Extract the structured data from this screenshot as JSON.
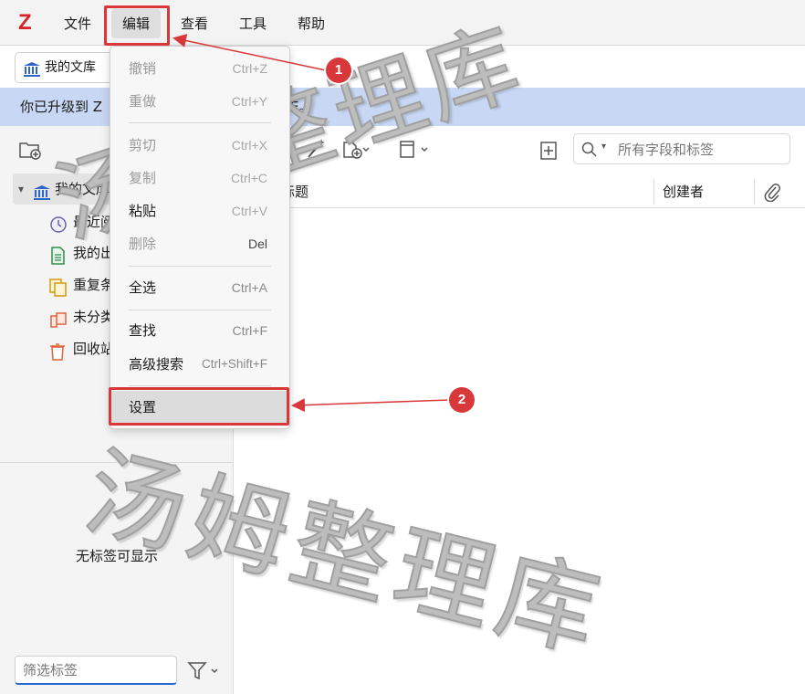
{
  "menubar": {
    "logo": "Z",
    "items": [
      {
        "label": "文件"
      },
      {
        "label": "编辑"
      },
      {
        "label": "查看"
      },
      {
        "label": "工具"
      },
      {
        "label": "帮助"
      }
    ]
  },
  "library_tab": {
    "label": "我的文库"
  },
  "banner": {
    "text_prefix": "你已升级到 Z",
    "text_suffix": "E。"
  },
  "collections": {
    "root": {
      "label": "我的文库"
    },
    "children": [
      {
        "label": "最近阅",
        "icon": "clock-icon"
      },
      {
        "label": "我的出",
        "icon": "document-icon"
      },
      {
        "label": "重复条",
        "icon": "duplicate-icon"
      },
      {
        "label": "未分类",
        "icon": "unfiled-icon"
      },
      {
        "label": "回收站",
        "icon": "trash-icon"
      }
    ]
  },
  "tags": {
    "empty_text": "无标签可显示",
    "filter_placeholder": "筛选标签"
  },
  "search": {
    "placeholder": "所有字段和标签"
  },
  "columns": {
    "title": "标题",
    "creator": "创建者"
  },
  "edit_menu": {
    "items": [
      {
        "label": "撤销",
        "shortcut": "Ctrl+Z",
        "enabled": false
      },
      {
        "label": "重做",
        "shortcut": "Ctrl+Y",
        "enabled": false
      },
      {
        "label": "剪切",
        "shortcut": "Ctrl+X",
        "enabled": false
      },
      {
        "label": "复制",
        "shortcut": "Ctrl+C",
        "enabled": false
      },
      {
        "label": "粘贴",
        "shortcut": "Ctrl+V",
        "enabled": true
      },
      {
        "label": "删除",
        "shortcut": "Del",
        "enabled": false
      },
      {
        "label": "全选",
        "shortcut": "Ctrl+A",
        "enabled": true
      },
      {
        "label": "查找",
        "shortcut": "Ctrl+F",
        "enabled": true
      },
      {
        "label": "高级搜索",
        "shortcut": "Ctrl+Shift+F",
        "enabled": true
      },
      {
        "label": "设置",
        "shortcut": "",
        "enabled": true
      }
    ]
  },
  "annotations": {
    "callout_1": "1",
    "callout_2": "2",
    "color": "#d9383a"
  },
  "watermark": {
    "text_1": "汤姆整理库",
    "text_2": "汤姆整理库"
  }
}
